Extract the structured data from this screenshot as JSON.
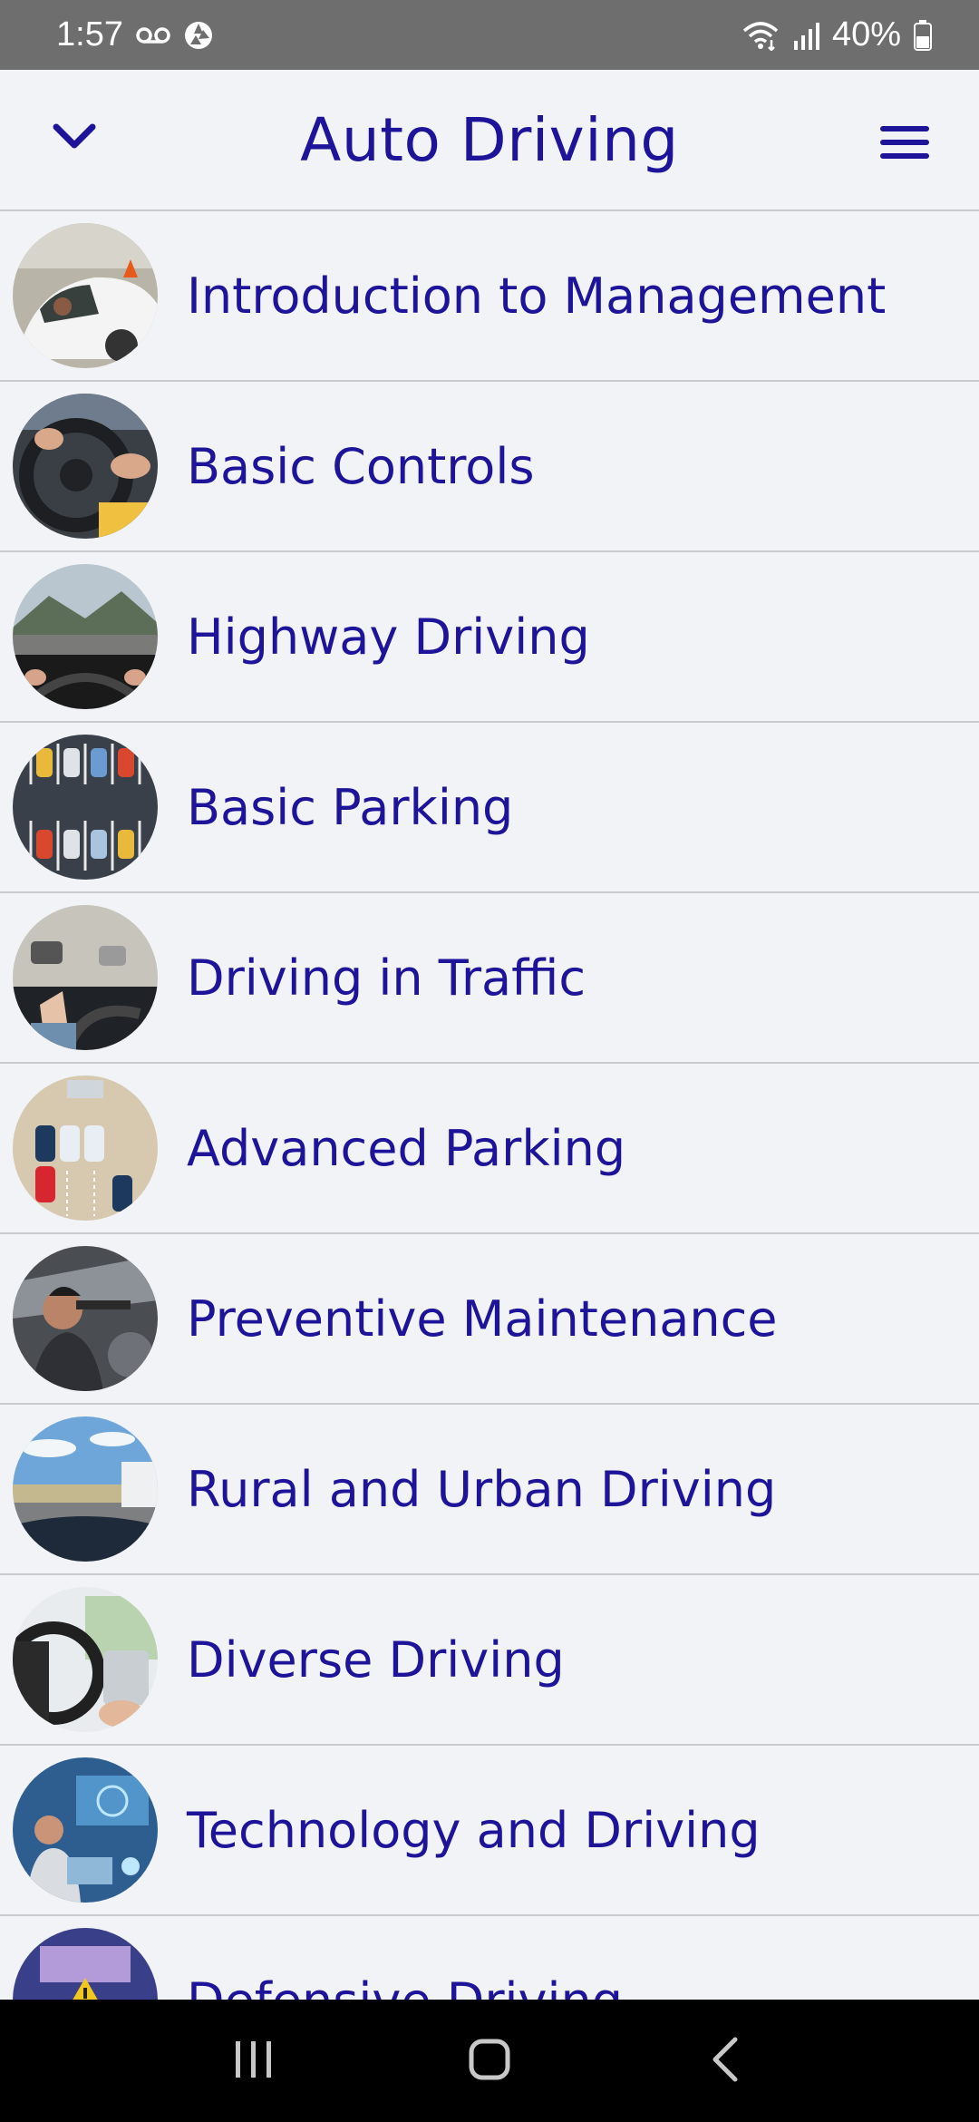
{
  "status_bar": {
    "time": "1:57",
    "battery": "40%",
    "icons": [
      "voicemail-icon",
      "camera-aperture-icon",
      "wifi-icon",
      "signal-icon",
      "battery-icon"
    ]
  },
  "header": {
    "title": "Auto Driving",
    "left_icon": "chevron-down-icon",
    "right_icon": "hamburger-menu-icon"
  },
  "colors": {
    "accent": "#1d1499",
    "background": "#f1f3f6",
    "divider": "#c9c9cf",
    "status_bar": "#6e6e6e",
    "nav_bar": "#000000"
  },
  "lessons": [
    {
      "label": "Introduction to Management",
      "thumbnail": "car-driver-window-photo"
    },
    {
      "label": "Basic Controls",
      "thumbnail": "steering-wheel-hands-photo"
    },
    {
      "label": "Highway Driving",
      "thumbnail": "highway-dashboard-photo"
    },
    {
      "label": "Basic Parking",
      "thumbnail": "parking-lot-aerial-photo"
    },
    {
      "label": "Driving in Traffic",
      "thumbnail": "traffic-driver-photo"
    },
    {
      "label": "Advanced Parking",
      "thumbnail": "parking-diagram-photo"
    },
    {
      "label": "Preventive Maintenance",
      "thumbnail": "mechanic-inspection-photo"
    },
    {
      "label": "Rural and Urban Driving",
      "thumbnail": "open-road-photo"
    },
    {
      "label": "Diverse Driving",
      "thumbnail": "car-interior-photo"
    },
    {
      "label": "Technology and Driving",
      "thumbnail": "autonomous-car-tech-photo"
    },
    {
      "label": "Defensive Driving",
      "thumbnail": "warning-road-photo"
    }
  ],
  "nav_bar": {
    "buttons": [
      "recent-apps-icon",
      "home-icon",
      "back-icon"
    ]
  }
}
